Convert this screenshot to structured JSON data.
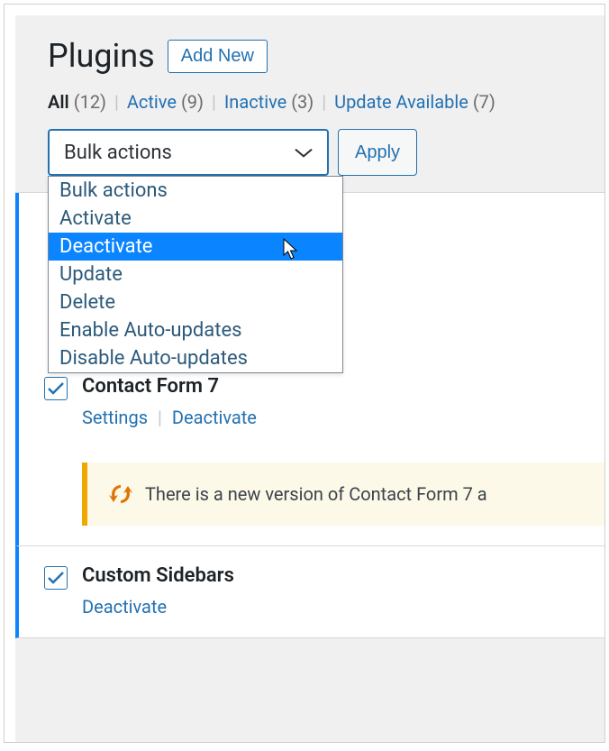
{
  "header": {
    "title": "Plugins",
    "add_new": "Add New"
  },
  "filters": {
    "all": {
      "label": "All",
      "count": "(12)"
    },
    "active": {
      "label": "Active",
      "count": "(9)"
    },
    "inactive": {
      "label": "Inactive",
      "count": "(3)"
    },
    "update": {
      "label": "Update Available",
      "count": "(7)"
    }
  },
  "bulk": {
    "selected": "Bulk actions",
    "options": {
      "o0": "Bulk actions",
      "o1": "Activate",
      "o2": "Deactivate",
      "o3": "Update",
      "o4": "Delete",
      "o5": "Enable Auto-updates",
      "o6": "Disable Auto-updates"
    },
    "apply": "Apply"
  },
  "plugins": {
    "p0": {
      "name": "Contact Form 7",
      "settings": "Settings",
      "deactivate": "Deactivate",
      "notice": "There is a new version of Contact Form 7 a"
    },
    "p1": {
      "name": "Custom Sidebars",
      "deactivate": "Deactivate"
    }
  }
}
